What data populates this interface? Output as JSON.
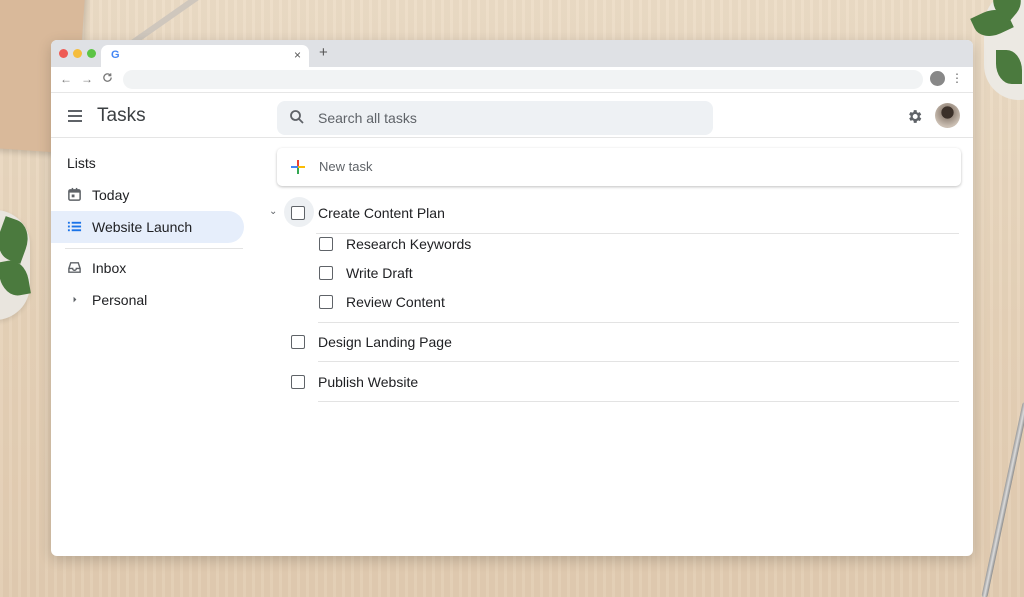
{
  "browser": {
    "tab_icon": "G",
    "tab_close": "×",
    "new_tab": "+",
    "nav": {
      "back": "←",
      "forward": "→",
      "reload": "C"
    }
  },
  "app": {
    "title": "Tasks",
    "search_placeholder": "Search all tasks"
  },
  "sidebar": {
    "heading": "Lists",
    "items": [
      {
        "label": "Today",
        "icon": "calendar-icon",
        "active": false
      },
      {
        "label": "Website Launch",
        "icon": "list-icon",
        "active": true
      },
      {
        "label": "Inbox",
        "icon": "inbox-icon",
        "active": false
      },
      {
        "label": "Personal",
        "icon": "caret-right-icon",
        "active": false
      }
    ]
  },
  "main": {
    "new_task_label": "New task",
    "tasks": [
      {
        "label": "Create Content Plan",
        "expanded": true,
        "subtasks": [
          {
            "label": "Research Keywords"
          },
          {
            "label": "Write Draft"
          },
          {
            "label": "Review Content"
          }
        ]
      },
      {
        "label": "Design Landing Page"
      },
      {
        "label": "Publish Website"
      }
    ]
  },
  "colors": {
    "accent_active": "#e6eefb",
    "google_blue": "#4285f4",
    "google_red": "#ea4335",
    "google_yellow": "#fbbc04",
    "google_green": "#34a853"
  }
}
